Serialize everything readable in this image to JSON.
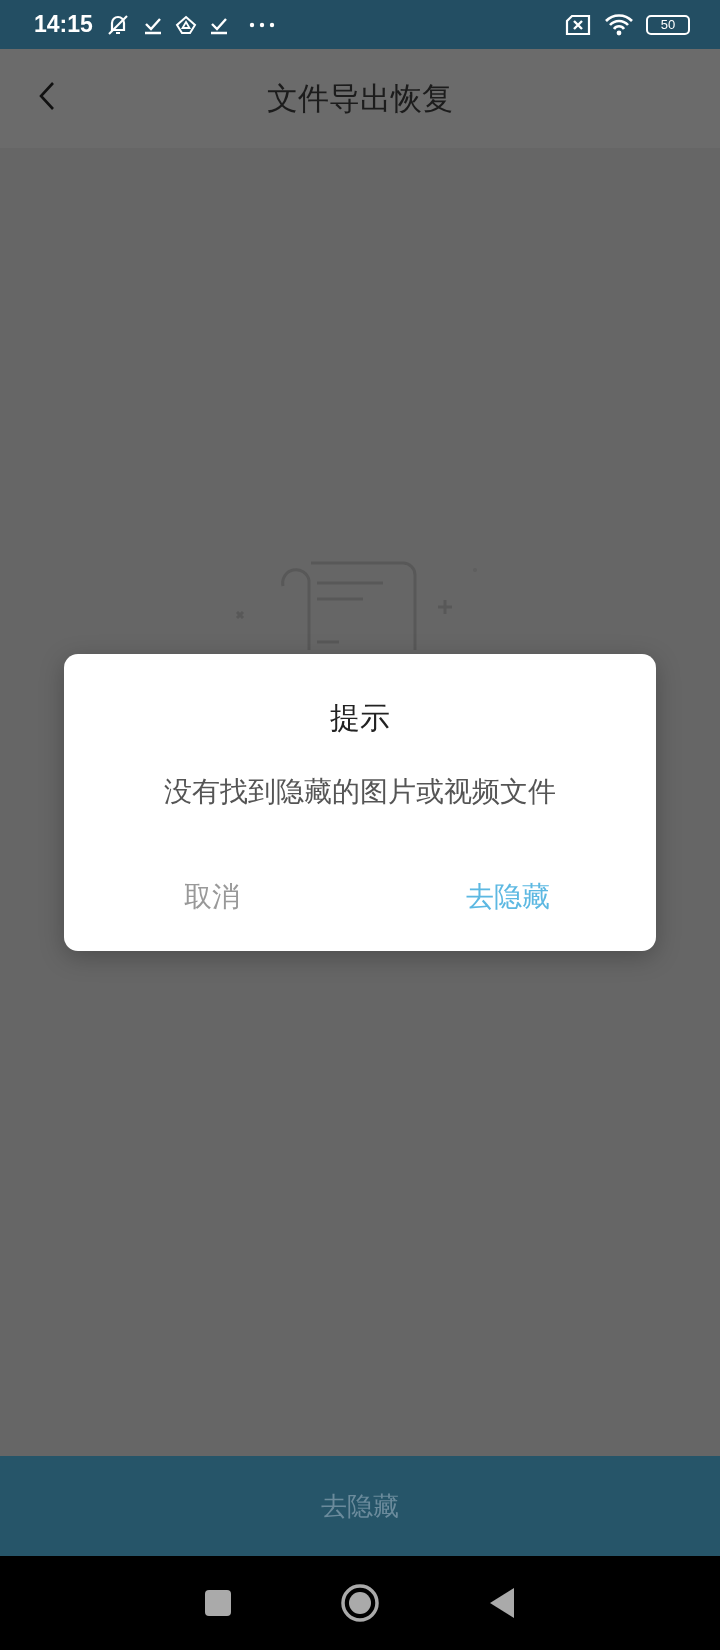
{
  "status_bar": {
    "time": "14:15",
    "battery": "50"
  },
  "header": {
    "title": "文件导出恢复"
  },
  "dialog": {
    "title": "提示",
    "message": "没有找到隐藏的图片或视频文件",
    "buttons": [
      {
        "label": "取消",
        "kind": "cancel"
      },
      {
        "label": "去隐藏",
        "kind": "primary"
      }
    ]
  },
  "bottom_button": {
    "label": "去隐藏"
  }
}
